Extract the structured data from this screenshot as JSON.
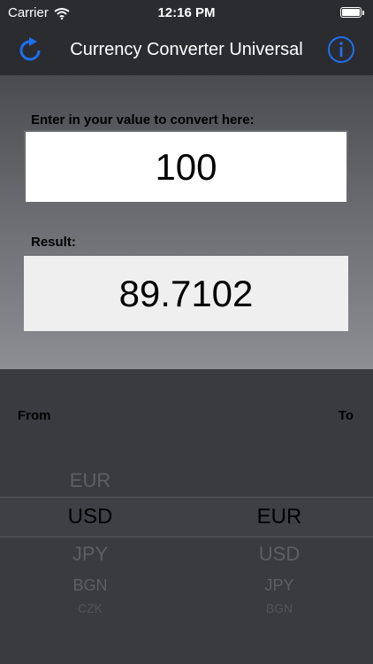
{
  "status_bar": {
    "carrier": "Carrier",
    "time": "12:16 PM",
    "battery_level": 1.0
  },
  "nav": {
    "title": "Currency Converter Universal",
    "left_icon": "refresh-icon",
    "right_icon": "info-icon"
  },
  "converter": {
    "input_label": "Enter in your value to convert here:",
    "input_value": "100",
    "result_label": "Result:",
    "result_value": "89.7102"
  },
  "picker": {
    "from_label": "From",
    "to_label": "To",
    "from_options": [
      "EUR",
      "USD",
      "JPY",
      "BGN",
      "CZK"
    ],
    "to_options": [
      "EUR",
      "USD",
      "JPY",
      "BGN"
    ],
    "from_selected": "USD",
    "to_selected": "EUR"
  },
  "colors": {
    "accent": "#1f6ff0"
  }
}
